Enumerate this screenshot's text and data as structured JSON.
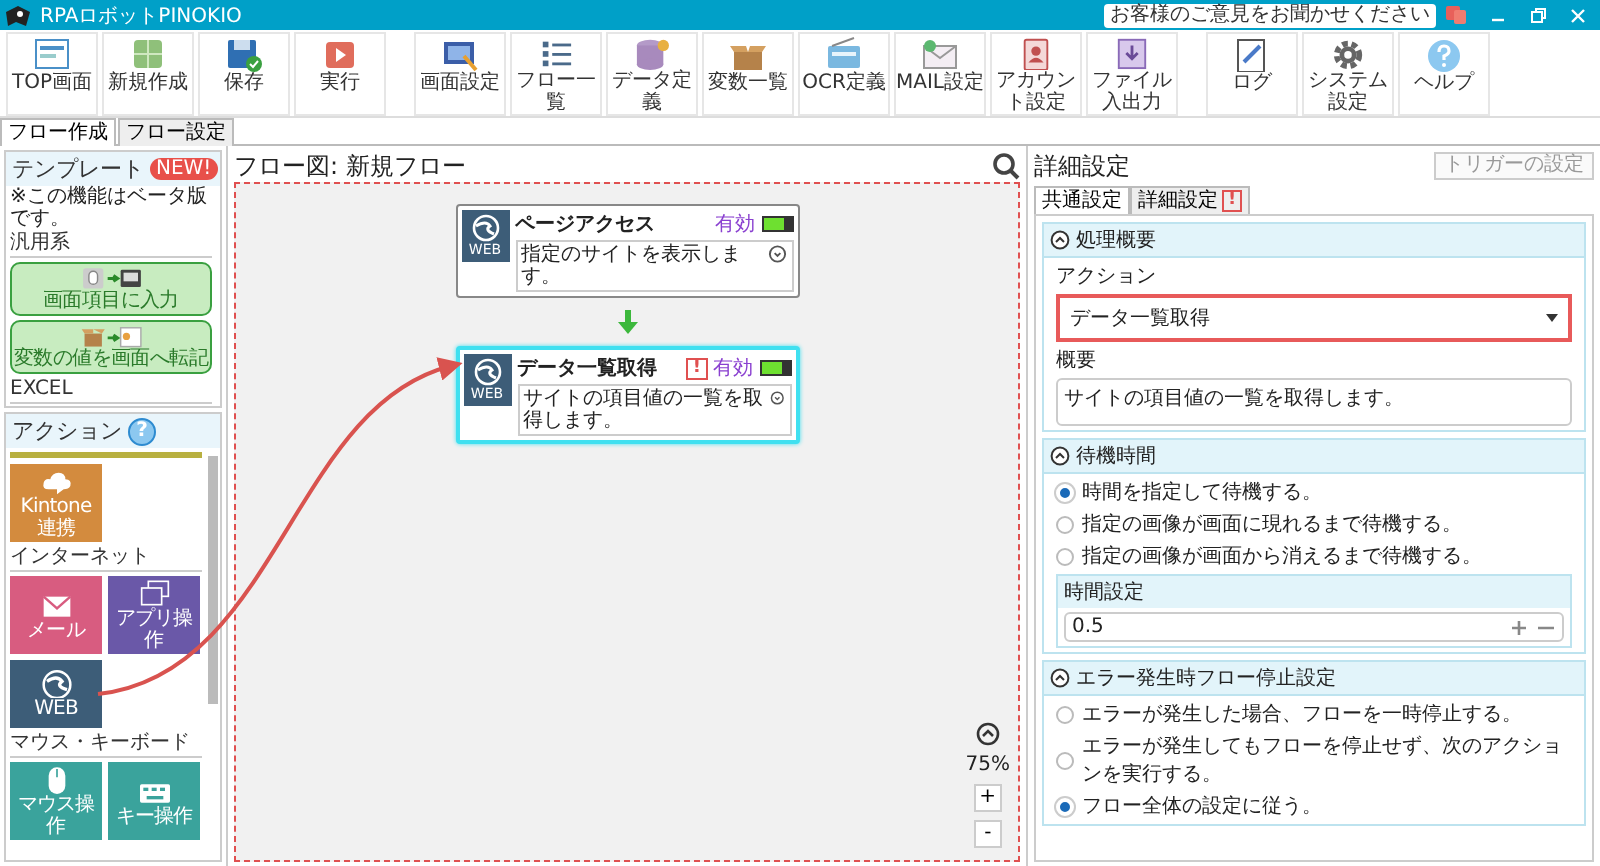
{
  "window": {
    "title": "RPAロボットPINOKIO",
    "feedback": "お客様のご意見をお聞かせください"
  },
  "toolbar": [
    {
      "label": "TOP画面",
      "kind": "page"
    },
    {
      "label": "新規作成",
      "kind": "new"
    },
    {
      "label": "保存",
      "kind": "save"
    },
    {
      "label": "実行",
      "kind": "run"
    },
    {
      "label": "画面設定",
      "kind": "screen",
      "group_start": true
    },
    {
      "label": "フロー一覧",
      "kind": "list"
    },
    {
      "label": "データ定義",
      "kind": "database"
    },
    {
      "label": "変数一覧",
      "kind": "box"
    },
    {
      "label": "OCR定義",
      "kind": "scan"
    },
    {
      "label": "MAIL設定",
      "kind": "mail"
    },
    {
      "label": "アカウント設定",
      "kind": "account"
    },
    {
      "label": "ファイル入出力",
      "kind": "file"
    },
    {
      "label": "ログ",
      "kind": "log",
      "group_start": true
    },
    {
      "label": "システム設定",
      "kind": "gear"
    },
    {
      "label": "ヘルプ",
      "kind": "help"
    }
  ],
  "tabs": [
    {
      "label": "フロー作成",
      "selected": true
    },
    {
      "label": "フロー設定",
      "selected": false
    }
  ],
  "templates": {
    "title": "テンプレート",
    "badge": "NEW!",
    "note": "※この機能はベータ版です。",
    "groups": [
      {
        "name": "汎用系",
        "items": [
          {
            "label": "画面項目に入力",
            "kind": "input"
          },
          {
            "label": "変数の値を画面へ転記",
            "kind": "transfer"
          }
        ]
      },
      {
        "name": "EXCEL"
      }
    ]
  },
  "actions": {
    "title": "アクション",
    "help": "?",
    "groups": [
      {
        "tiles": [
          {
            "label": "Kintone連携",
            "kind": "cloud",
            "color": "#d38b3e"
          }
        ]
      },
      {
        "name": "インターネット",
        "tiles": [
          {
            "label": "メール",
            "kind": "mail",
            "color": "#d85c80"
          },
          {
            "label": "アプリ操作",
            "kind": "windows",
            "color": "#6a58a8"
          },
          {
            "label": "WEB",
            "kind": "globe",
            "color": "#3d5d78"
          }
        ]
      },
      {
        "name": "マウス・キーボード",
        "tiles": [
          {
            "label": "マウス操作",
            "kind": "mouse",
            "color": "#3aa39c"
          },
          {
            "label": "キー操作",
            "kind": "keyboard",
            "color": "#3aa39c"
          }
        ]
      }
    ]
  },
  "canvas": {
    "title": "フロー図: 新規フロー",
    "zoom": "75%",
    "zoom_in": "+",
    "zoom_out": "-",
    "nodes": [
      {
        "title": "ページアクセス",
        "description": "指定のサイトを表示します。",
        "icon_label": "WEB",
        "status": "有効",
        "enabled": true,
        "selected": false
      },
      {
        "title": "データ一覧取得",
        "description": "サイトの項目値の一覧を取得します。",
        "icon_label": "WEB",
        "status": "有効",
        "enabled": true,
        "selected": true,
        "warning_mark": "!"
      }
    ]
  },
  "detail": {
    "title": "詳細設定",
    "trigger_button": "トリガーの設定",
    "tabs": [
      {
        "label": "共通設定",
        "selected": true
      },
      {
        "label": "詳細設定",
        "selected": false,
        "warning_mark": "!"
      }
    ],
    "sections": [
      {
        "title": "処理概要",
        "expanded": true,
        "kind": "summary",
        "action_label": "アクション",
        "action_value": "データ一覧取得",
        "summary_label": "概要",
        "summary_value": "サイトの項目値の一覧を取得します。"
      },
      {
        "title": "待機時間",
        "expanded": true,
        "kind": "options",
        "options": [
          {
            "label": "時間を指定して待機する。",
            "selected": true
          },
          {
            "label": "指定の画像が画面に現れるまで待機する。",
            "selected": false
          },
          {
            "label": "指定の画像が画面から消えるまで待機する。",
            "selected": false
          }
        ],
        "field_label": "時間設定",
        "field_value": "0.5"
      },
      {
        "title": "エラー発生時フロー停止設定",
        "expanded": true,
        "kind": "options",
        "options": [
          {
            "label": "エラーが発生した場合、フローを一時停止する。",
            "selected": false
          },
          {
            "label": "エラーが発生してもフローを停止せず、次のアクションを実行する。",
            "selected": false
          },
          {
            "label": "フロー全体の設定に従う。",
            "selected": true
          }
        ]
      }
    ]
  }
}
